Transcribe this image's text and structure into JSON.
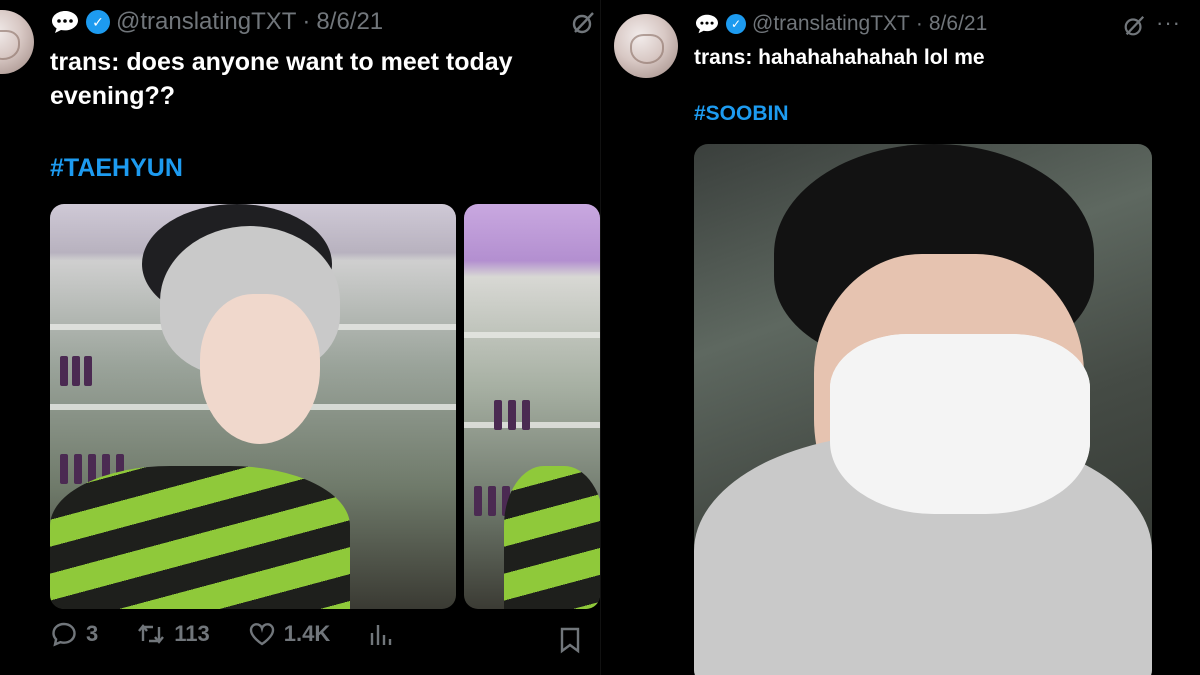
{
  "tweets": [
    {
      "handle": "@translatingTXT",
      "separator": "·",
      "date": "8/6/21",
      "text": "trans: does anyone want to meet today evening??",
      "hashtag": "#TAEHYUN",
      "stats": {
        "replies": "3",
        "retweets": "113",
        "likes": "1.4K"
      }
    },
    {
      "handle": "@translatingTXT",
      "separator": "·",
      "date": "8/6/21",
      "text": "trans: hahahahahahah lol me",
      "hashtag": "#SOOBIN",
      "more": "···"
    }
  ],
  "colors": {
    "accent": "#1d9bf0",
    "muted": "#71767b",
    "text": "#e7e9ea",
    "background": "#000000"
  },
  "icons": [
    "speech-bubble-icon",
    "verified-badge-icon",
    "grok-icon",
    "reply-icon",
    "retweet-icon",
    "like-icon",
    "views-icon",
    "bookmark-icon"
  ]
}
